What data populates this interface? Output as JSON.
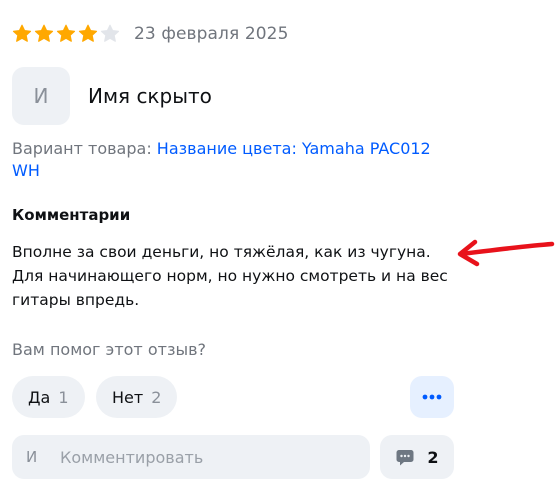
{
  "review": {
    "rating": 4,
    "max_rating": 5,
    "date": "23 февраля 2025",
    "author_initial": "И",
    "author_name": "Имя скрыто",
    "variant_label": "Вариант товара:",
    "variant_value": "Название цвета: Yamaha PAC012 WH",
    "comments_title": "Комментарии",
    "comment_text": "Вполне за свои деньги, но тяжёлая, как из чугуна. Для начинающего норм, но нужно смотреть и на вес гитары впредь."
  },
  "helpful": {
    "question": "Вам помог этот отзыв?",
    "yes_label": "Да",
    "yes_count": "1",
    "no_label": "Нет",
    "no_count": "2"
  },
  "comment_box": {
    "avatar_initial": "И",
    "placeholder": "Комментировать",
    "replies_count": "2"
  },
  "icons": {
    "star_filled": "star-filled-icon",
    "star_empty": "star-empty-icon",
    "more": "more-dots-icon",
    "comments": "comment-bubble-icon",
    "annotation_arrow": "red-arrow-icon"
  },
  "colors": {
    "star_filled": "#ffa800",
    "star_empty": "#e2e5ea",
    "accent": "#005bff",
    "annotation": "#e8121b",
    "chip_bg": "#eef1f5"
  }
}
